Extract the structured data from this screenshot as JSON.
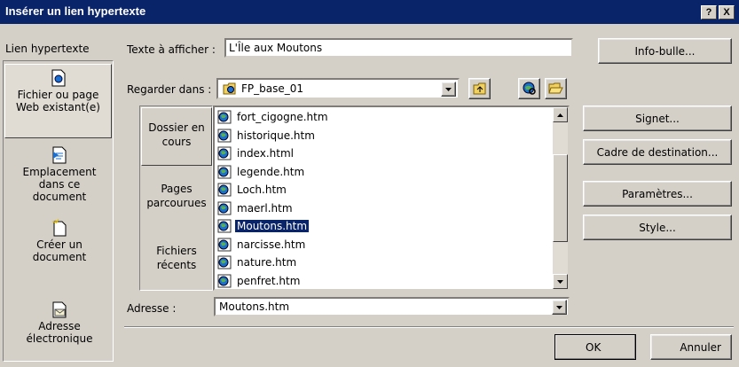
{
  "window": {
    "title": "Insérer un lien hypertexte",
    "help_btn": "?",
    "close_btn": "X"
  },
  "nav": {
    "header": "Lien hypertexte",
    "items": [
      {
        "label": "Fichier ou page Web existant(e)",
        "icon": "web-page-icon",
        "selected": true
      },
      {
        "label": "Emplacement dans ce document",
        "icon": "document-location-icon"
      },
      {
        "label": "Créer un document",
        "icon": "new-document-icon"
      },
      {
        "label": "Adresse électronique",
        "icon": "email-icon"
      }
    ]
  },
  "display_text": {
    "label": "Texte à afficher :",
    "value": "L'Île aux Moutons"
  },
  "tooltip_button": "Info-bulle...",
  "look_in": {
    "label": "Regarder dans :",
    "value": "FP_base_01"
  },
  "subnav": [
    {
      "label": "Dossier en cours",
      "selected": true
    },
    {
      "label": "Pages parcourues"
    },
    {
      "label": "Fichiers récents"
    }
  ],
  "files": [
    "fort_cigogne.htm",
    "historique.htm",
    "index.html",
    "legende.htm",
    "Loch.htm",
    "maerl.htm",
    "Moutons.htm",
    "narcisse.htm",
    "nature.htm",
    "penfret.htm"
  ],
  "selected_file": "Moutons.htm",
  "right_buttons": {
    "bookmark": "Signet...",
    "target_frame": "Cadre de destination...",
    "parameters": "Paramètres...",
    "style": "Style..."
  },
  "address": {
    "label": "Adresse :",
    "value": "Moutons.htm"
  },
  "ok": "OK",
  "cancel": "Annuler"
}
